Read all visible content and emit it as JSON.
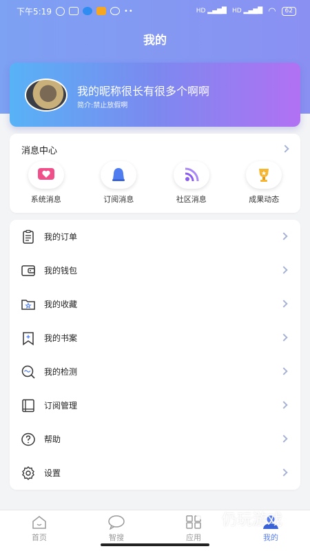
{
  "status_bar": {
    "time": "下午5:19",
    "signal_1": "HD",
    "signal_2": "HD",
    "battery": "62"
  },
  "header": {
    "title": "我的"
  },
  "profile": {
    "nickname": "我的昵称很长有很多个啊啊",
    "bio": "简介:禁止放假啊"
  },
  "messages": {
    "title": "消息中心",
    "items": [
      {
        "label": "系统消息",
        "icon": "heart-chat-icon",
        "color": "#f0508a"
      },
      {
        "label": "订阅消息",
        "icon": "bell-icon",
        "color": "#4f7df0"
      },
      {
        "label": "社区消息",
        "icon": "rss-icon",
        "color": "#8a5cf0"
      },
      {
        "label": "成果动态",
        "icon": "trophy-icon",
        "color": "#f5b632"
      }
    ]
  },
  "menu": {
    "items": [
      {
        "label": "我的订单",
        "icon": "clipboard-icon"
      },
      {
        "label": "我的钱包",
        "icon": "wallet-icon"
      },
      {
        "label": "我的收藏",
        "icon": "star-folder-icon"
      },
      {
        "label": "我的书案",
        "icon": "bookmark-icon"
      },
      {
        "label": "我的检测",
        "icon": "search-wave-icon"
      },
      {
        "label": "订阅管理",
        "icon": "book-icon"
      },
      {
        "label": "帮助",
        "icon": "help-icon"
      },
      {
        "label": "设置",
        "icon": "gear-icon"
      }
    ]
  },
  "tabbar": {
    "items": [
      {
        "label": "首页",
        "icon": "home-icon",
        "active": false
      },
      {
        "label": "智搜",
        "icon": "search-bubble-icon",
        "active": false
      },
      {
        "label": "应用",
        "icon": "apps-icon",
        "active": false
      },
      {
        "label": "我的",
        "icon": "user-icon",
        "active": true
      }
    ]
  },
  "watermark": {
    "main": "仍玩游戏",
    "sub": "Rengwan.com"
  },
  "colors": {
    "accent": "#5a7ff0",
    "header_gradient_start": "#7da1f3",
    "header_gradient_end": "#8a90f2",
    "chevron": "#a7b3d6"
  }
}
